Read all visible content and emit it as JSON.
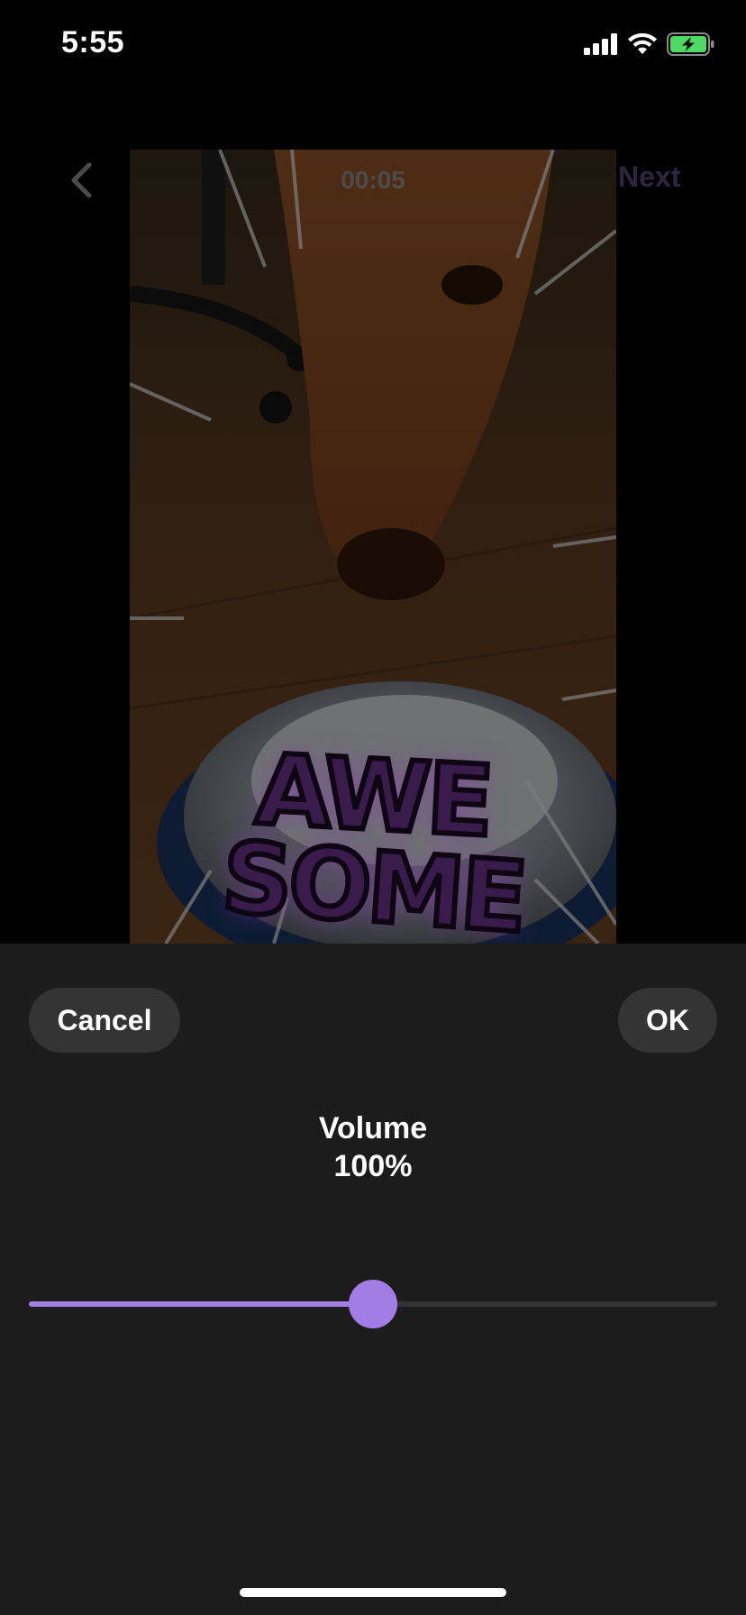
{
  "status_bar": {
    "time": "5:55",
    "icons": [
      "cellular-signal-icon",
      "wifi-icon",
      "battery-charging-icon"
    ],
    "battery_color": "#4cd964"
  },
  "header": {
    "back_icon": "chevron-left-icon",
    "timecode": "00:05",
    "next_label": "Next"
  },
  "video": {
    "sticker_lines": [
      "AWE",
      "SOME"
    ]
  },
  "sheet": {
    "cancel_label": "Cancel",
    "ok_label": "OK",
    "volume_title": "Volume",
    "volume_value": "100%"
  },
  "slider": {
    "level": 0.5,
    "accent_color": "#a27de6",
    "track_color": "#343434"
  }
}
